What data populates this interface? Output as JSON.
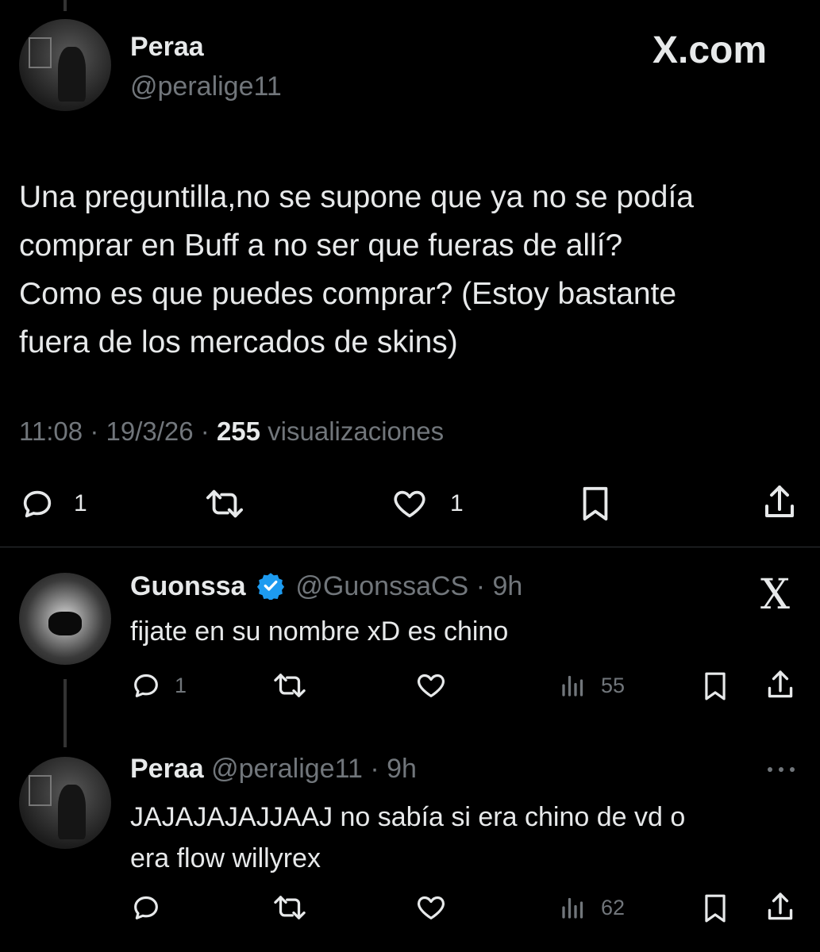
{
  "brand": {
    "watermark": "X.com",
    "corner_x": "X"
  },
  "main_post": {
    "author_name": "Peraa",
    "author_handle": "@peralige11",
    "text_lines": [
      "Una preguntilla,no se supone que ya no se podía",
      "comprar en Buff a no ser que fueras de allí?",
      "Como es que puedes comprar? (Estoy bastante",
      "fuera de los mercados de skins)"
    ],
    "time": "11:08",
    "sep": "·",
    "date": "19/3/26",
    "views_count": "255",
    "views_label": "visualizaciones",
    "reply_count": "1",
    "like_count": "1"
  },
  "replies": [
    {
      "author_name": "Guonssa",
      "author_handle": "@GuonssaCS",
      "age": "9h",
      "text_lines": [
        "fijate en su nombre xD es chino"
      ],
      "reply_count": "1",
      "view_count": "55"
    },
    {
      "author_name": "Peraa",
      "author_handle": "@peralige11",
      "age": "9h",
      "text_lines": [
        "JAJAJAJAJJAAJ no sabía si era chino de vd o",
        "era flow willyrex"
      ],
      "view_count": "62"
    }
  ],
  "colors": {
    "background": "#000000",
    "text": "#e7e9ea",
    "muted": "#71767b",
    "verified": "#1d9bf0",
    "divider": "#2f3336"
  }
}
